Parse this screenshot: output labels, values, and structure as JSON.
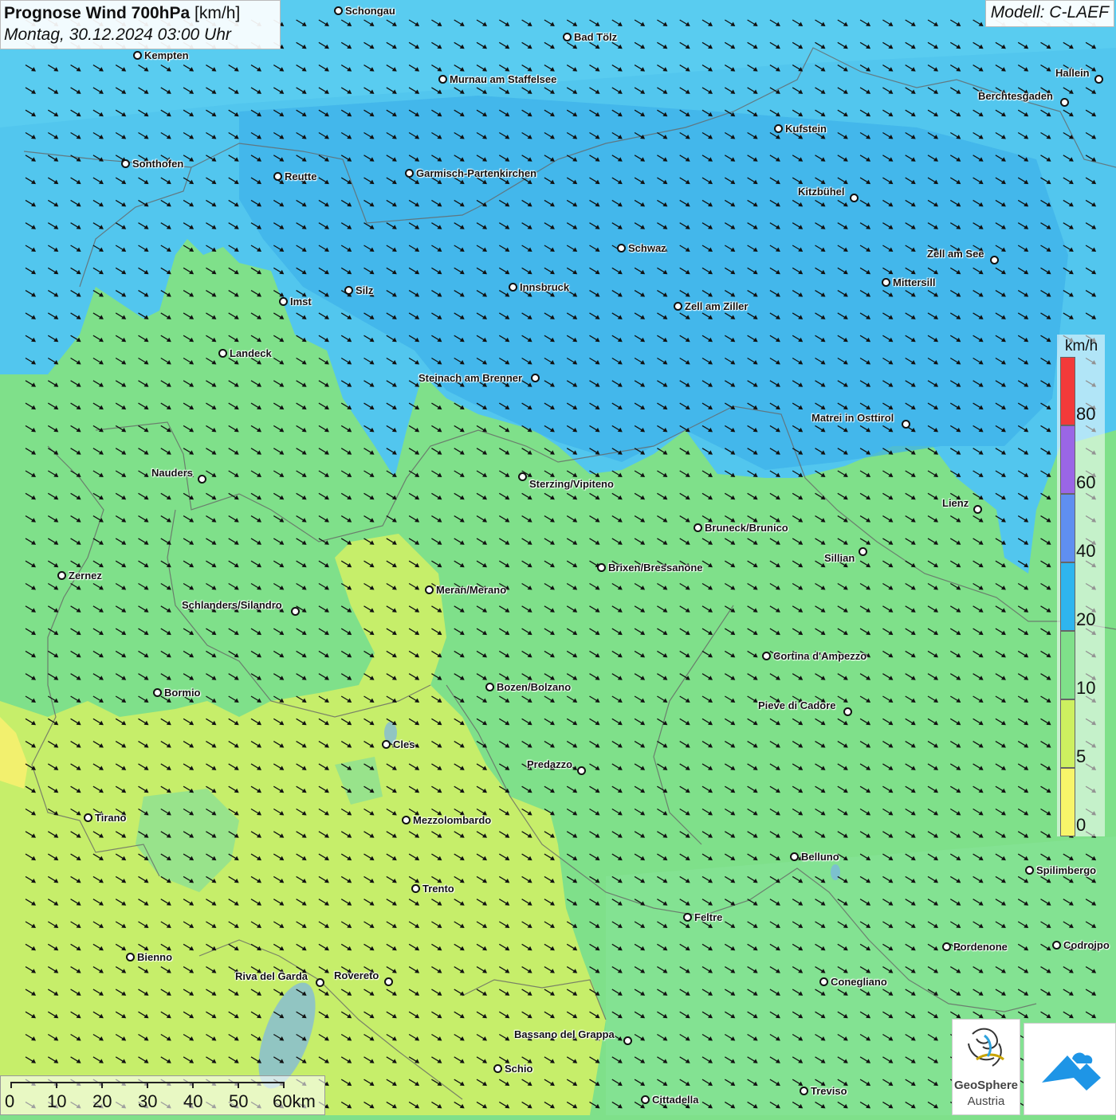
{
  "header": {
    "title_bold": "Prognose Wind 700hPa",
    "title_unit": " [km/h]",
    "datetime": "Montag, 30.12.2024 03:00 Uhr"
  },
  "model": {
    "label": "Modell: C-LAEF"
  },
  "legend": {
    "unit": "km/h",
    "labels": [
      "80",
      "60",
      "40",
      "20",
      "10",
      "5",
      "0"
    ],
    "colors": {
      "above_80": "#f33a3a",
      "60_80": "#9a66e6",
      "40_60": "#5f8ff0",
      "20_40": "#2fb5ee",
      "10_20": "#7fe08a",
      "5_10": "#cdf060",
      "0_5": "#f7f56a"
    }
  },
  "scale_bar": {
    "labels": [
      "0",
      "10",
      "20",
      "30",
      "40",
      "50",
      "60km"
    ]
  },
  "cities": [
    "Schongau",
    "Bad Tölz",
    "Kempten",
    "Murnau am Staffelsee",
    "Hallein",
    "Berchtesgaden",
    "Kufstein",
    "Sonthofen",
    "Reutte",
    "Garmisch-Partenkirchen",
    "Kitzbühel",
    "Schwaz",
    "Zell am See",
    "Mittersill",
    "Innsbruck",
    "Silz",
    "Imst",
    "Zell am Ziller",
    "Landeck",
    "Steinach am Brenner",
    "Matrei in Osttirol",
    "Nauders",
    "Sterzing/Vipiteno",
    "Lienz",
    "Bruneck/Brunico",
    "Sillian",
    "Brixen/Bressanone",
    "Zernez",
    "Meran/Merano",
    "Schlanders/Silandro",
    "Cortina d'Ampezzo",
    "Bozen/Bolzano",
    "Bormio",
    "Pieve di Cadore",
    "Cles",
    "Predazzo",
    "Tirano",
    "Mezzolombardo",
    "Belluno",
    "Spilimbergo",
    "Trento",
    "Feltre",
    "Pordenone",
    "Codroipo",
    "Bienno",
    "Riva del Garda",
    "Rovereto",
    "Conegliano",
    "Bassano del Grappa",
    "Schio",
    "Treviso",
    "Cittadella"
  ],
  "logos": {
    "geosphere_line1": "GeoSphere",
    "geosphere_line2": "Austria"
  },
  "wind_field": {
    "direction": "north-west wind (arrows pointing south-east)"
  }
}
